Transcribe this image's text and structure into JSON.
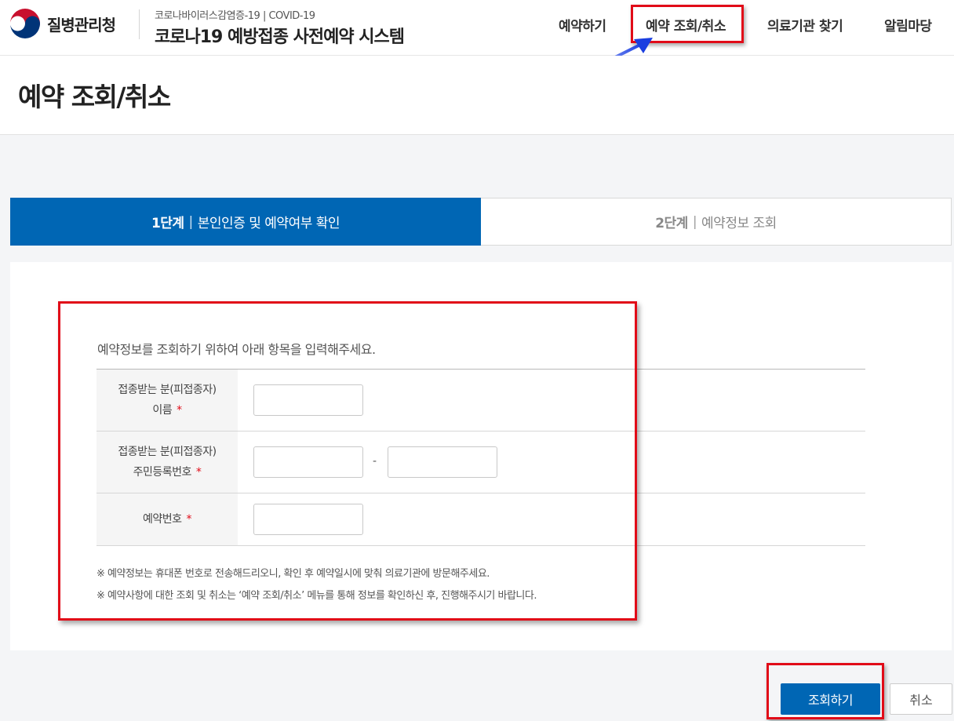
{
  "header": {
    "agency_name": "질병관리청",
    "system_subtitle": "코로나바이러스감염증-19 | COVID-19",
    "system_title": "코로나19 예방접종 사전예약 시스템",
    "nav": [
      {
        "label": "예약하기",
        "icon": "none"
      },
      {
        "label": "예약 조회/취소",
        "active": true
      },
      {
        "label": "의료기관 찾기"
      },
      {
        "label": "알림마당"
      }
    ]
  },
  "page": {
    "title": "예약 조회/취소"
  },
  "steps": [
    {
      "number": "1단계",
      "separator": "|",
      "label": "본인인증 및 예약여부 확인",
      "active": true
    },
    {
      "number": "2단계",
      "separator": "|",
      "label": "예약정보 조회",
      "active": false
    }
  ],
  "form": {
    "intro": "예약정보를 조회하기 위하여 아래 항목을 입력해주세요.",
    "required_mark": "*",
    "fields": [
      {
        "label_line1": "접종받는 분(피접종자)",
        "label_line2": "이름",
        "value": "",
        "placeholder": ""
      },
      {
        "label_line1": "접종받는 분(피접종자)",
        "label_line2": "주민등록번호",
        "value_front": "",
        "value_back": "",
        "separator": "-"
      },
      {
        "label_line1": "예약번호",
        "value": "",
        "placeholder": ""
      }
    ],
    "notes": [
      "※ 예약정보는 휴대폰 번호로 전송해드리오니, 확인 후 예약일시에 맞춰 의료기관에 방문해주세요.",
      "※ 예약사항에 대한 조회 및 취소는 ‘예약 조회/취소’ 메뉴를 통해 정보를 확인하신 후, 진행해주시기 바랍니다."
    ]
  },
  "buttons": {
    "submit": "조회하기",
    "cancel": "취소"
  },
  "colors": {
    "primary": "#0066b4",
    "annotation_red": "#e10b18",
    "annotation_arrow": "#1a3ee0"
  }
}
